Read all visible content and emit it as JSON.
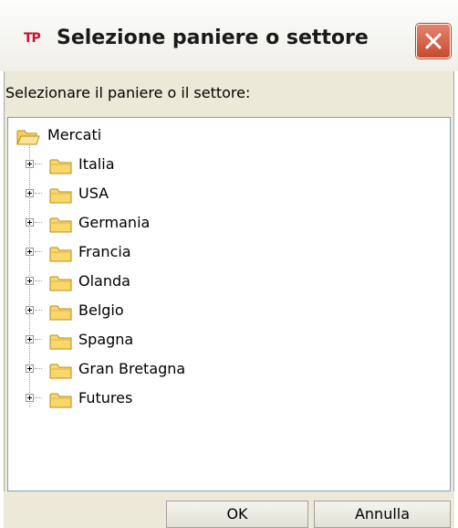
{
  "window": {
    "title": "Selezione paniere o settore",
    "app_icon_text": "TP"
  },
  "prompt_label": "Selezionare il paniere o il settore:",
  "tree": {
    "root": {
      "label": "Mercati",
      "icon": "folder-open-icon"
    },
    "children": [
      {
        "label": "Italia",
        "icon": "folder-icon",
        "expandable": true
      },
      {
        "label": "USA",
        "icon": "folder-icon",
        "expandable": true
      },
      {
        "label": "Germania",
        "icon": "folder-icon",
        "expandable": true
      },
      {
        "label": "Francia",
        "icon": "folder-icon",
        "expandable": true
      },
      {
        "label": "Olanda",
        "icon": "folder-icon",
        "expandable": true
      },
      {
        "label": "Belgio",
        "icon": "folder-icon",
        "expandable": true
      },
      {
        "label": "Spagna",
        "icon": "folder-icon",
        "expandable": true
      },
      {
        "label": "Gran Bretagna",
        "icon": "folder-icon",
        "expandable": true
      },
      {
        "label": "Futures",
        "icon": "folder-icon",
        "expandable": true
      }
    ]
  },
  "buttons": {
    "ok_label": "OK",
    "cancel_label": "Annulla"
  },
  "colors": {
    "folder_fill": "#f9d86b",
    "folder_stroke": "#b98c1e",
    "close_button": "#d0573a",
    "frame_bg": "#ece9d8"
  }
}
